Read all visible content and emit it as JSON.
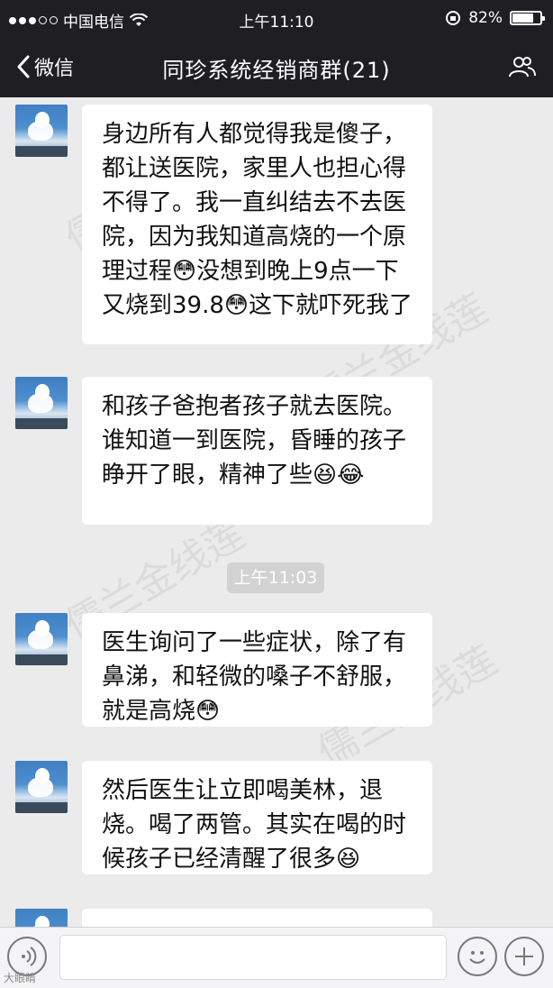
{
  "status_bar": {
    "carrier": "中国电信",
    "time": "上午11:10",
    "battery": "82%",
    "battery_level": 0.82
  },
  "nav": {
    "back_label": "微信",
    "title": "同珍系统经销商群(21)"
  },
  "messages": [
    {
      "text": "身边所有人都觉得我是傻子，都让送医院，家里人也担心得不得了。我一直纠结去不去医院，因为我知道高烧的一个原理过程😳没想到晚上9点一下又烧到39.8😳这下就吓死我了"
    },
    {
      "text": "和孩子爸抱者孩子就去医院。谁知道一到医院，昏睡的孩子睁开了眼，精神了些😆😂"
    },
    {
      "text": "医生询问了一些症状，除了有鼻涕，和轻微的嗓子不舒服，就是高烧😳"
    },
    {
      "text": "然后医生让立即喝美林，退烧。喝了两管。其实在喝的时候孩子已经清醒了很多😆"
    }
  ],
  "timestamp_divider": "上午11:03",
  "watermark_text": "儒兰金线莲",
  "corner_mark": "大眼睛"
}
